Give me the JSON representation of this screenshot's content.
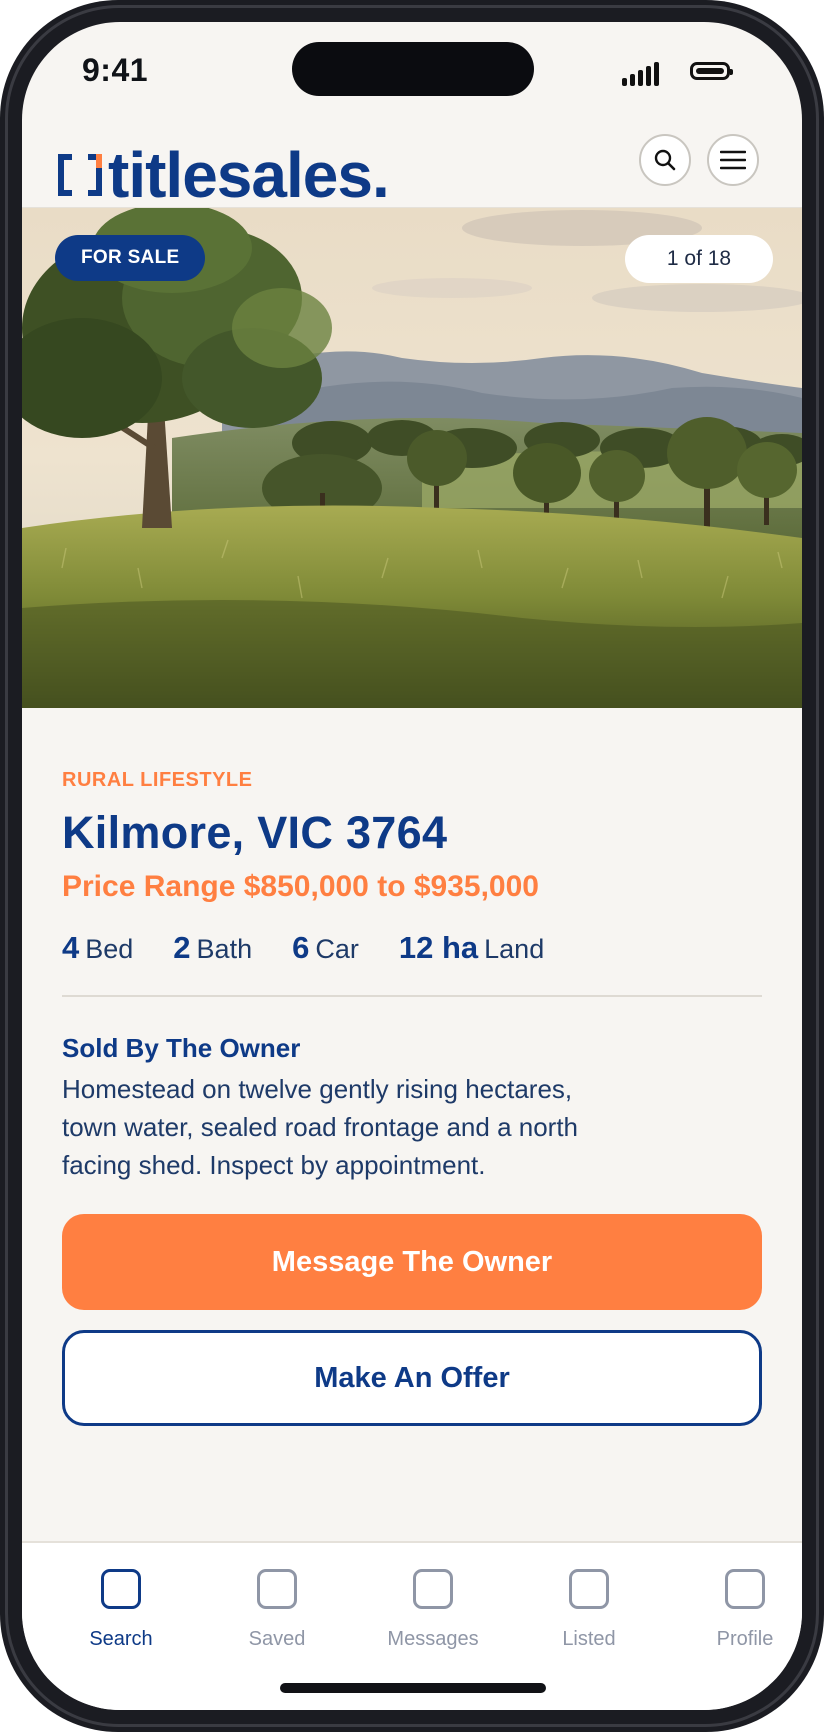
{
  "status_bar": {
    "time": "9:41"
  },
  "header": {
    "logo_text": "titlesales.",
    "search_icon": "search-icon",
    "menu_icon": "menu-icon"
  },
  "listing": {
    "badge": "FOR SALE",
    "photo_counter": "1 of 18",
    "category": "RURAL LIFESTYLE",
    "title": "Kilmore, VIC 3764",
    "price": "Price Range $850,000 to $935,000",
    "specs": [
      {
        "value": "4",
        "unit": "Bed"
      },
      {
        "value": "2",
        "unit": "Bath"
      },
      {
        "value": "6",
        "unit": "Car"
      },
      {
        "value": "12 ha",
        "unit": "Land"
      }
    ],
    "seller_heading": "Sold By The Owner",
    "description": "Homestead on twelve gently rising hectares, town water, sealed road frontage and a north facing shed. Inspect by appointment."
  },
  "actions": {
    "primary_label": "Message The Owner",
    "secondary_label": "Make An Offer"
  },
  "tabbar": {
    "items": [
      {
        "label": "Search",
        "active": true
      },
      {
        "label": "Saved",
        "active": false
      },
      {
        "label": "Messages",
        "active": false
      },
      {
        "label": "Listed",
        "active": false
      },
      {
        "label": "Profile",
        "active": false
      }
    ]
  },
  "colors": {
    "brand_navy": "#0e3a87",
    "accent_orange": "#ff7f41",
    "background": "#f7f5f2",
    "muted": "#8f96a6"
  }
}
